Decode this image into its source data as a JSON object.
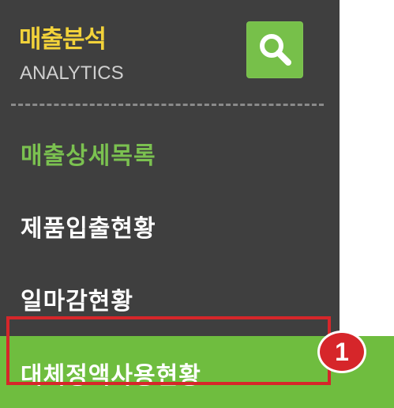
{
  "header": {
    "title": "매출분석",
    "subtitle": "ANALYTICS",
    "search_icon": "search-icon"
  },
  "menu": {
    "items": [
      {
        "label": "매출상세목록"
      },
      {
        "label": "제품입출현황"
      },
      {
        "label": "일마감현황"
      },
      {
        "label": "대체정액사용현황"
      }
    ]
  },
  "annotation": {
    "badge_number": "1"
  },
  "colors": {
    "panel_bg": "#3f3f3f",
    "title": "#f2d23a",
    "accent_green": "#77c04a",
    "active_text": "#7bc150",
    "highlight_red": "#d6262a"
  }
}
